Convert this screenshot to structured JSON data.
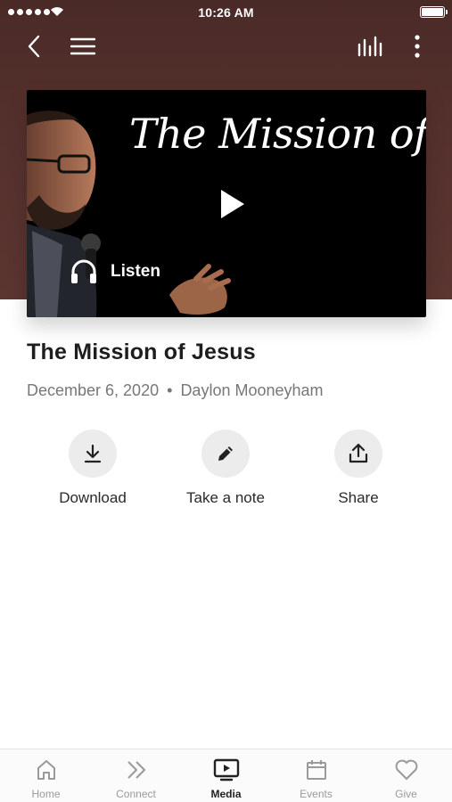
{
  "status_bar": {
    "time": "10:26 AM"
  },
  "nav": {
    "back_icon": "chevron-left-icon",
    "menu_icon": "hamburger-menu-icon",
    "audio_icon": "equalizer-icon",
    "more_icon": "more-vertical-icon"
  },
  "video": {
    "title_text": "The Mission of Jesus",
    "play_icon": "play-icon",
    "listen_label": "Listen"
  },
  "sermon": {
    "title": "The Mission of Jesus",
    "date": "December 6, 2020",
    "separator": "•",
    "speaker": "Daylon Mooneyham"
  },
  "actions": [
    {
      "label": "Download",
      "icon": "download-icon"
    },
    {
      "label": "Take a note",
      "icon": "pencil-icon"
    },
    {
      "label": "Share",
      "icon": "share-icon"
    }
  ],
  "tabs": [
    {
      "label": "Home",
      "icon": "home-icon",
      "active": false
    },
    {
      "label": "Connect",
      "icon": "double-chevron-right-icon",
      "active": false
    },
    {
      "label": "Media",
      "icon": "tv-play-icon",
      "active": true
    },
    {
      "label": "Events",
      "icon": "calendar-icon",
      "active": false
    },
    {
      "label": "Give",
      "icon": "heart-icon",
      "active": false
    }
  ],
  "colors": {
    "header_background": "#55312d",
    "action_circle": "#ececec",
    "tab_active": "#222222",
    "tab_inactive": "#9a9a9a"
  }
}
